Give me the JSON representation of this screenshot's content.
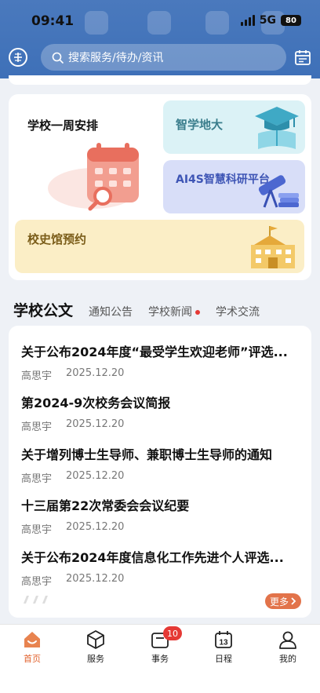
{
  "status_bar": {
    "time": "09:41",
    "network": "5G",
    "battery": "80"
  },
  "header": {
    "search_placeholder": "搜索服务/待办/资讯"
  },
  "quick_entries": {
    "week_schedule": "学校一周安排",
    "zhixue": "智学地大",
    "ai4s": "AI4S智慧科研平台",
    "history_museum": "校史馆预约"
  },
  "news_tabs": [
    {
      "label": "学校公文",
      "active": true
    },
    {
      "label": "通知公告"
    },
    {
      "label": "学校新闻",
      "has_dot": true
    },
    {
      "label": "学术交流"
    }
  ],
  "documents": [
    {
      "title": "关于公布2024年度“最受学生欢迎老师”评选...",
      "author": "高思宇",
      "date": "2025.12.20"
    },
    {
      "title": "第2024-9次校务会议简报",
      "author": "高思宇",
      "date": "2025.12.20"
    },
    {
      "title": "关于增列博士生导师、兼职博士生导师的通知",
      "author": "高思宇",
      "date": "2025.12.20"
    },
    {
      "title": "十三届第22次常委会会议纪要",
      "author": "高思宇",
      "date": "2025.12.20"
    },
    {
      "title": "关于公布2024年度信息化工作先进个人评选...",
      "author": "高思宇",
      "date": "2025.12.20"
    }
  ],
  "more_label": "更多",
  "tabbar": [
    {
      "label": "首页",
      "icon": "home-icon",
      "active": true
    },
    {
      "label": "服务",
      "icon": "cube-icon"
    },
    {
      "label": "事务",
      "icon": "inbox-icon",
      "badge": "10"
    },
    {
      "label": "日程",
      "icon": "calendar-icon",
      "day": "13"
    },
    {
      "label": "我的",
      "icon": "person-icon"
    }
  ],
  "colors": {
    "brand_blue": "#4272b9",
    "accent_orange": "#e2734a",
    "badge_red": "#e53935"
  }
}
